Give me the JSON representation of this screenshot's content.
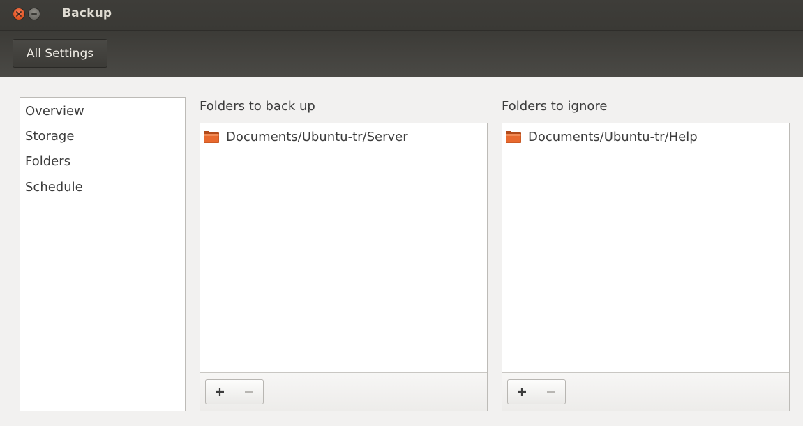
{
  "window": {
    "title": "Backup",
    "close_icon": "close-icon",
    "minimize_icon": "minimize-icon"
  },
  "toolbar": {
    "all_settings_label": "All Settings"
  },
  "sidebar": {
    "items": [
      {
        "label": "Overview"
      },
      {
        "label": "Storage"
      },
      {
        "label": "Folders"
      },
      {
        "label": "Schedule"
      }
    ]
  },
  "backup_panel": {
    "heading": "Folders to back up",
    "items": [
      {
        "icon": "folder-icon",
        "label": "Documents/Ubuntu-tr/Server"
      }
    ],
    "add_icon": "plus-icon",
    "remove_icon": "minus-icon"
  },
  "ignore_panel": {
    "heading": "Folders to ignore",
    "items": [
      {
        "icon": "folder-icon",
        "label": "Documents/Ubuntu-tr/Help"
      }
    ],
    "add_icon": "plus-icon",
    "remove_icon": "minus-icon"
  },
  "colors": {
    "close_button": "#e05422",
    "folder_icon": "#e0622a",
    "title_bar": "#3c3b37"
  }
}
